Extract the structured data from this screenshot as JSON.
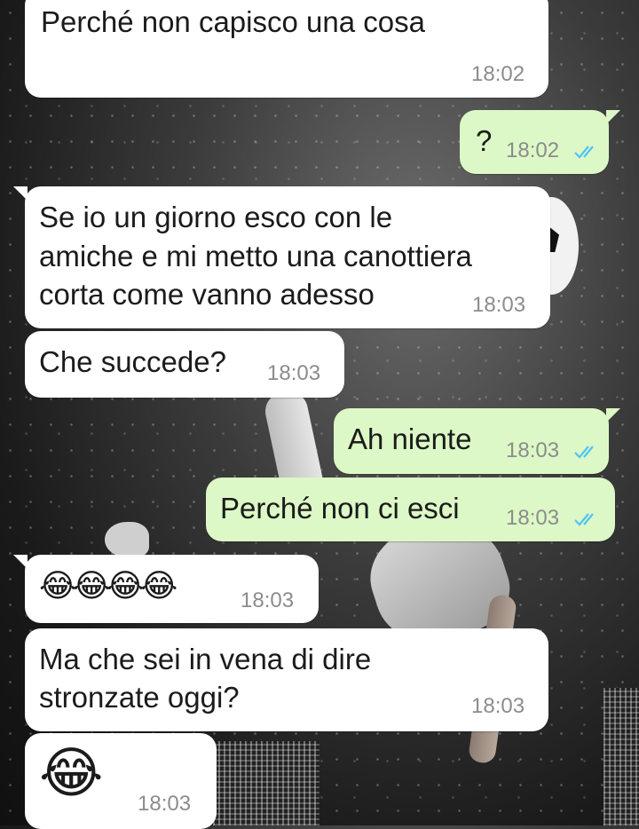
{
  "colors": {
    "incoming_bubble": "#ffffff",
    "outgoing_bubble": "#dcf8c6",
    "timestamp": "#8c8c8c",
    "read_ticks": "#4fc3f7"
  },
  "messages": [
    {
      "direction": "in",
      "text": "Perché non capisco una cosa",
      "time": "18:02"
    },
    {
      "direction": "out",
      "text": "?",
      "time": "18:02",
      "status": "read",
      "status_icon": "double-check-icon"
    },
    {
      "direction": "in",
      "lines": [
        "Se io un giorno esco con le",
        "amiche e mi metto una canottiera",
        "corta come vanno adesso"
      ],
      "time": "18:03"
    },
    {
      "direction": "in",
      "text": "Che succede?",
      "time": "18:03"
    },
    {
      "direction": "out",
      "text": "Ah niente",
      "time": "18:03",
      "status": "read",
      "status_icon": "double-check-icon"
    },
    {
      "direction": "out",
      "text": "Perché non ci esci",
      "time": "18:03",
      "status": "read",
      "status_icon": "double-check-icon"
    },
    {
      "direction": "in",
      "text": "😂😂😂😂",
      "time": "18:03",
      "emoji_name": "face-with-tears-of-joy"
    },
    {
      "direction": "in",
      "lines": [
        "Ma che sei in vena di dire",
        "stronzate oggi?"
      ],
      "time": "18:03"
    },
    {
      "direction": "in",
      "text": "😂",
      "time": "18:03",
      "emoji_name": "face-with-tears-of-joy"
    }
  ]
}
